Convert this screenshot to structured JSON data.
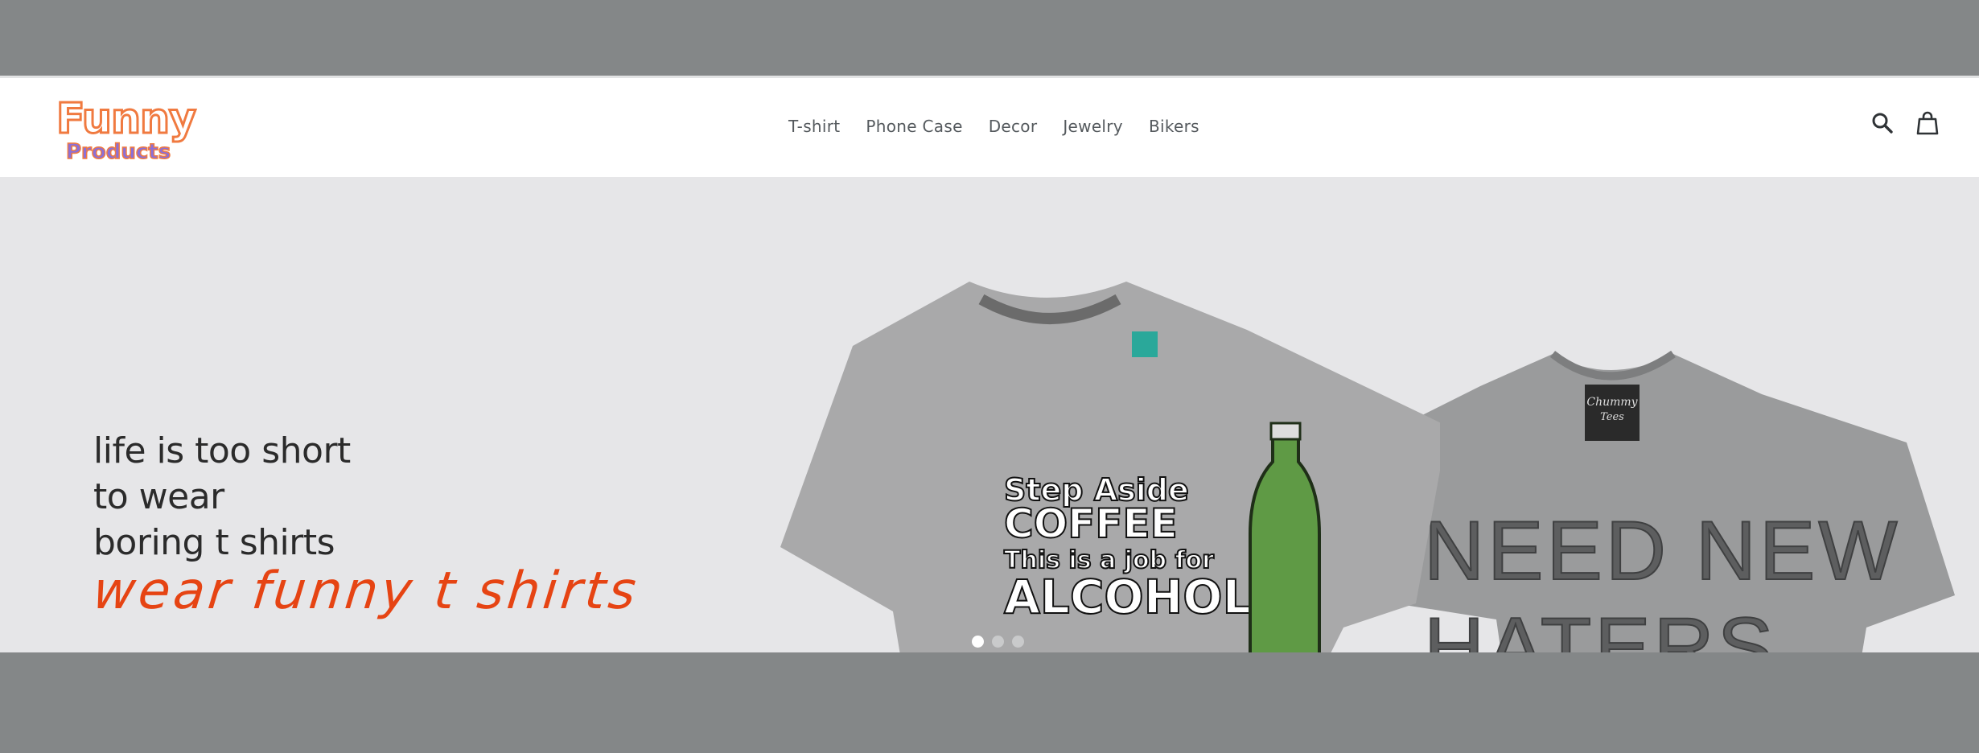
{
  "header": {
    "logo": {
      "word1": "Funny",
      "word2": "Products"
    },
    "nav": [
      {
        "label": "T-shirt"
      },
      {
        "label": "Phone Case"
      },
      {
        "label": "Decor"
      },
      {
        "label": "Jewelry"
      },
      {
        "label": "Bikers"
      }
    ],
    "icons": [
      "search-icon",
      "cart-icon"
    ]
  },
  "hero": {
    "lines": [
      "life is too short",
      "to wear",
      "boring t shirts"
    ],
    "cta": "wear funny t shirts",
    "shirt1": {
      "line1": "Step Aside",
      "line2": "COFFEE",
      "line3": "This is a job for",
      "line4": "ALCOHOL"
    },
    "shirt2": {
      "tag1": "Chummy",
      "tag2": "Tees",
      "line1": "NEED NEW",
      "line2": "HATERS"
    },
    "slides": {
      "count": 3,
      "active": 1
    }
  },
  "colors": {
    "accent": "#e64413",
    "logo_orange": "#f07a40",
    "logo_purple": "#8b6fd8",
    "overlay": "#848788",
    "hero_bg": "#e6e6e8"
  }
}
